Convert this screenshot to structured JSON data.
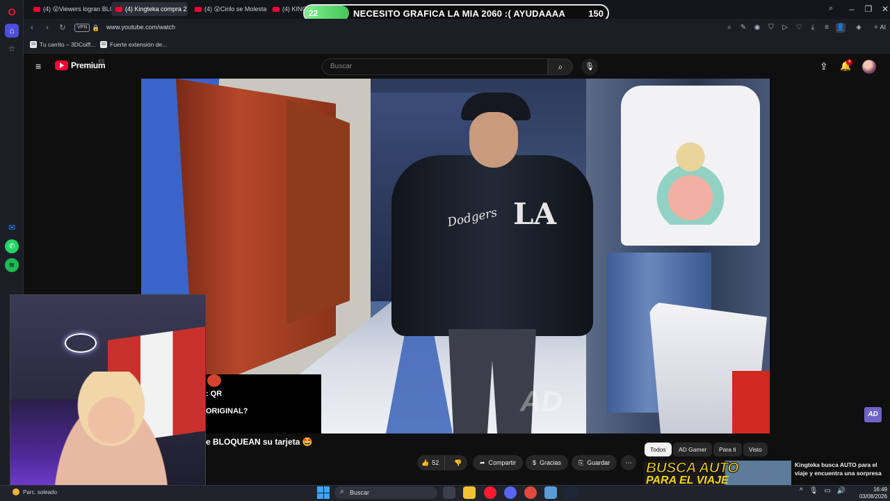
{
  "browser": {
    "tabs": [
      {
        "label": "(4) 😮Viewers logran BLO",
        "active": false
      },
      {
        "label": "(4) Kingteka compra 2 iPh",
        "active": true
      },
      {
        "label": "(4) 😮Cirilo se Molesta po",
        "active": false
      },
      {
        "label": "(4) KINGT",
        "active": false
      }
    ],
    "vpn_label": "VPN",
    "url": "www.youtube.com/watch",
    "ai_label": "AI",
    "bookmarks": [
      {
        "label": "Tu carrito – 3DCoiff...",
        "icon_text": "3D"
      },
      {
        "label": "Fuerte extensión de...",
        "icon_text": "3D"
      }
    ]
  },
  "goal_overlay": {
    "current": "22",
    "text": "NECESITO GRAFICA LA MIA 2060 :( AYUDAAAA",
    "target": "150",
    "progress": 0.147,
    "fill_color": "#44c45a"
  },
  "youtube": {
    "logo_text": "Premium",
    "region": "ES",
    "search_placeholder": "Buscar",
    "notification_count": "4",
    "watermark": "AD",
    "actions": {
      "like_count": "52",
      "share": "Compartir",
      "thanks": "Gracias",
      "save": "Guardar"
    },
    "chips": [
      {
        "label": "Todos",
        "active": true
      },
      {
        "label": "AD Gamer",
        "active": false
      },
      {
        "label": "Para ti",
        "active": false
      },
      {
        "label": "Visto",
        "active": false
      }
    ],
    "recommendation": {
      "thumb_line1": "BUSCA AUTO",
      "thumb_line2": "PARA EL VIAJE",
      "title": "Kingteka busca AUTO para el viaje y encuentra una sorpresa"
    }
  },
  "stream_chat": {
    "lines": [
      ": QR",
      "ORIGINAL?"
    ],
    "bottom": "e BLOQUEAN su tarjeta 🤩"
  },
  "taskbar": {
    "weather": "Parc. soleado",
    "search": "Buscar",
    "time": "16:49",
    "date": "03/08/2026"
  },
  "colors": {
    "yt_red": "#ff0033",
    "opera_red": "#ff1b2d",
    "accent_blue": "#3fa4f3"
  }
}
